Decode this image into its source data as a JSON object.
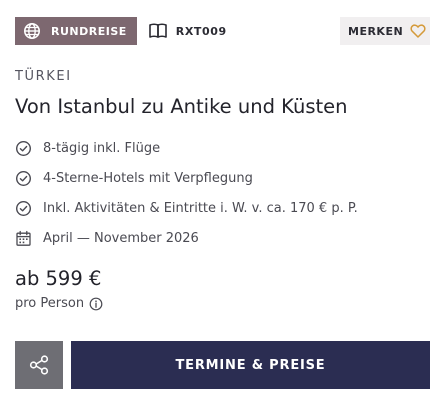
{
  "badge": {
    "label": "RUNDREISE",
    "icon": "globe-icon"
  },
  "trip_code": {
    "label": "RXT009",
    "icon": "book-icon"
  },
  "favorite": {
    "label": "MERKEN",
    "icon": "heart-icon",
    "accent_color": "#d49a3a"
  },
  "country": "TÜRKEI",
  "title": "Von Istanbul zu Antike und Küsten",
  "features": [
    {
      "text": "8-tägig inkl. Flüge",
      "icon": "check-circle-icon"
    },
    {
      "text": "4-Sterne-Hotels mit Verpflegung",
      "icon": "check-circle-icon"
    },
    {
      "text": "Inkl. Aktivitäten & Eintritte i. W. v. ca. 170 € p. P.",
      "icon": "check-circle-icon"
    },
    {
      "text": "April — November 2026",
      "icon": "calendar-icon"
    }
  ],
  "price": {
    "label": "ab 599 €",
    "per_person": "pro Person",
    "info_icon": "info-icon"
  },
  "actions": {
    "share_icon": "share-icon",
    "cta_label": "TERMINE & PREISE"
  },
  "colors": {
    "badge_bg": "#7d6870",
    "merken_bg": "#f1eff0",
    "share_bg": "#6e6e74",
    "cta_bg": "#2b2d52",
    "heart": "#d49a3a"
  }
}
